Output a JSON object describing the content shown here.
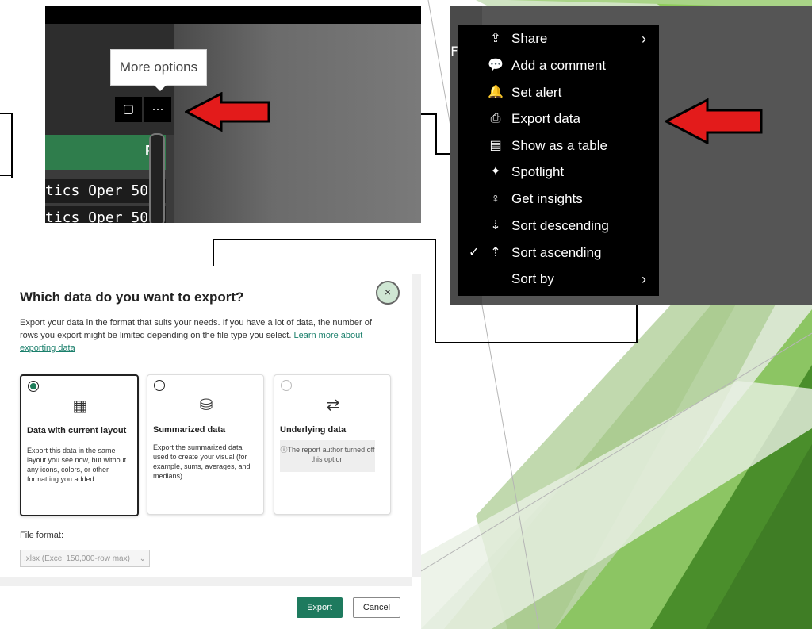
{
  "panel_a": {
    "tooltip": "More options",
    "copy_icon": "copy-icon",
    "more_button": "···",
    "column_header": "Fu",
    "rows": [
      "tics Oper  50",
      "tics Oper  50"
    ]
  },
  "context_menu": {
    "items": [
      {
        "icon": "⇪",
        "label": "Share",
        "chevron": "›",
        "check": ""
      },
      {
        "icon": "💬",
        "label": "Add a comment",
        "chevron": "",
        "check": ""
      },
      {
        "icon": "🔔",
        "label": "Set alert",
        "chevron": "",
        "check": ""
      },
      {
        "icon": "⎙",
        "label": "Export data",
        "chevron": "",
        "check": ""
      },
      {
        "icon": "▤",
        "label": "Show as a table",
        "chevron": "",
        "check": ""
      },
      {
        "icon": "✦",
        "label": "Spotlight",
        "chevron": "",
        "check": ""
      },
      {
        "icon": "♀",
        "label": "Get insights",
        "chevron": "",
        "check": ""
      },
      {
        "icon": "⇣",
        "label": "Sort descending",
        "chevron": "",
        "check": ""
      },
      {
        "icon": "⇡",
        "label": "Sort ascending",
        "chevron": "",
        "check": "✓"
      },
      {
        "icon": "",
        "label": "Sort by",
        "chevron": "›",
        "check": ""
      }
    ],
    "side_stub": "Fu"
  },
  "dialog": {
    "title": "Which data do you want to export?",
    "close_icon": "×",
    "description": "Export your data in the format that suits your needs. If you have a lot of data, the number of rows you export might be limited depending on the file type you select.",
    "learn_more": "Learn more about exporting data",
    "options": [
      {
        "title": "Data with current layout",
        "text": "Export this data in the same layout you see now, but without any icons, colors, or other formatting you added.",
        "icon": "▦",
        "selected": true
      },
      {
        "title": "Summarized data",
        "text": "Export the summarized data used to create your visual (for example, sums, averages, and medians).",
        "icon": "⛁",
        "selected": false
      },
      {
        "title": "Underlying data",
        "text": "ⓘThe report author turned off this option",
        "icon": "⇄",
        "selected": false
      }
    ],
    "file_format_label": "File format:",
    "file_format_value": ".xlsx (Excel 150,000-row max)",
    "export_label": "Export",
    "cancel_label": "Cancel"
  },
  "colors": {
    "accent_green": "#1e7a5e",
    "arrow_red": "#e31b1b",
    "menu_bg": "#000000"
  }
}
